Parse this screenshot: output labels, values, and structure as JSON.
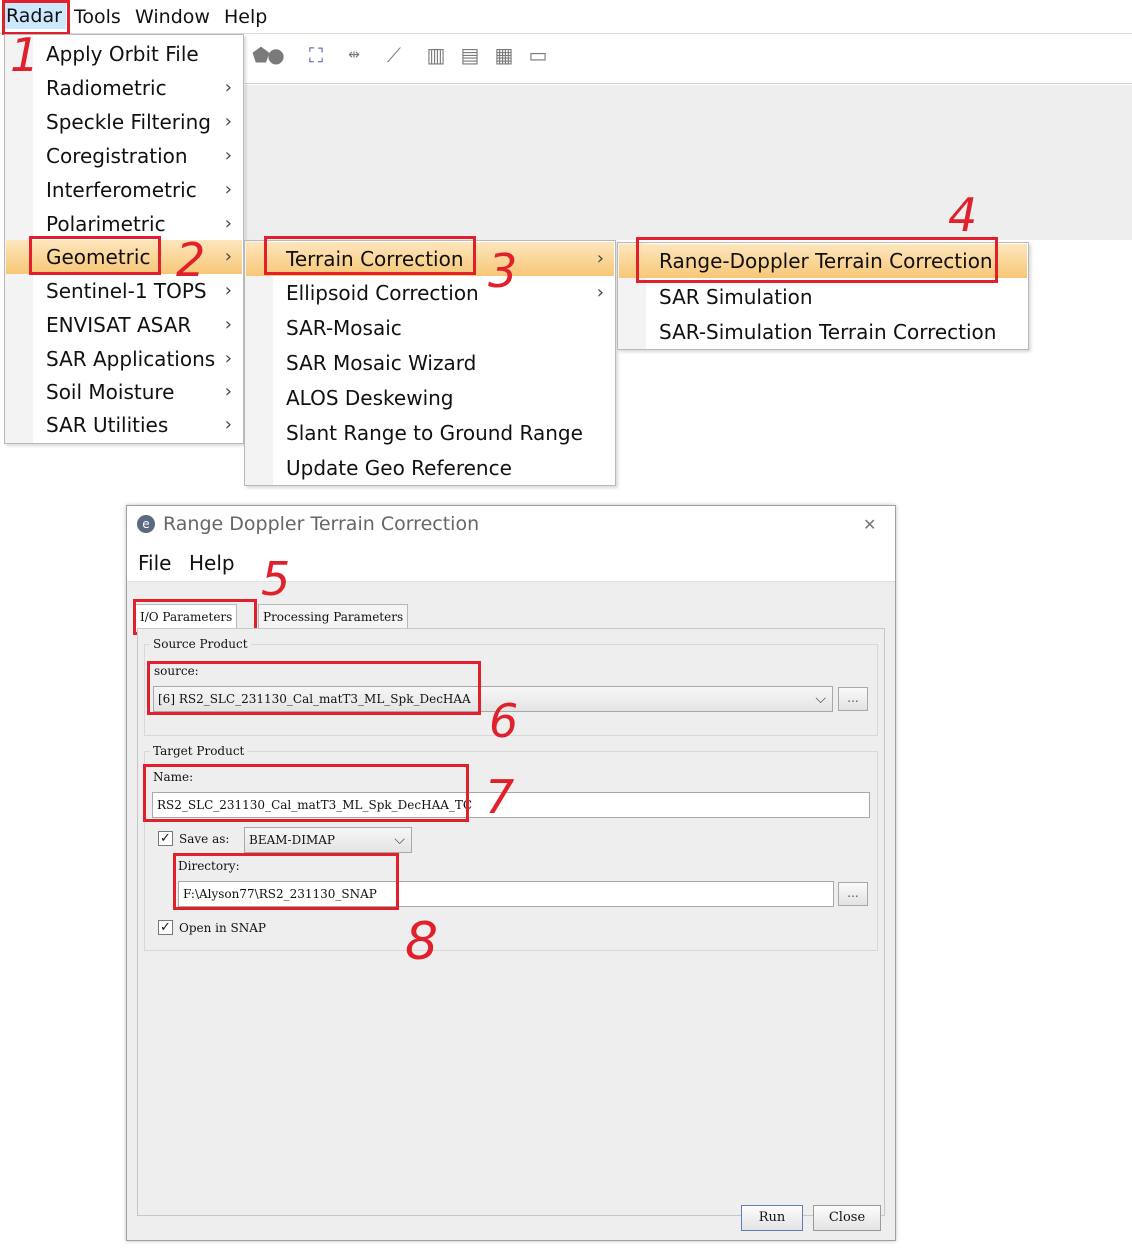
{
  "menubar": {
    "items": [
      "Radar",
      "Tools",
      "Window",
      "Help"
    ]
  },
  "toolbar": {
    "icons": [
      "shape-icon",
      "globe-icon",
      "window-star-icon",
      "distance-icon",
      "wand-icon",
      "tile-columns-icon",
      "tile-rows-icon",
      "tile-grid-icon",
      "folder-icon"
    ]
  },
  "radar_menu": {
    "items": [
      {
        "label": "Apply Orbit File",
        "submenu": false
      },
      {
        "label": "Radiometric",
        "submenu": true
      },
      {
        "label": "Speckle Filtering",
        "submenu": true
      },
      {
        "label": "Coregistration",
        "submenu": true
      },
      {
        "label": "Interferometric",
        "submenu": true
      },
      {
        "label": "Polarimetric",
        "submenu": true
      },
      {
        "label": "Geometric",
        "submenu": true
      },
      {
        "label": "Sentinel-1 TOPS",
        "submenu": true
      },
      {
        "label": "ENVISAT ASAR",
        "submenu": true
      },
      {
        "label": "SAR Applications",
        "submenu": true
      },
      {
        "label": "Soil Moisture",
        "submenu": true
      },
      {
        "label": "SAR Utilities",
        "submenu": true
      }
    ],
    "arrow": "›"
  },
  "geometric_menu": {
    "items": [
      {
        "label": "Terrain Correction",
        "submenu": true
      },
      {
        "label": "Ellipsoid Correction",
        "submenu": true
      },
      {
        "label": "SAR-Mosaic",
        "submenu": false
      },
      {
        "label": "SAR Mosaic Wizard",
        "submenu": false
      },
      {
        "label": "ALOS Deskewing",
        "submenu": false
      },
      {
        "label": "Slant Range to Ground Range",
        "submenu": false
      },
      {
        "label": "Update Geo Reference",
        "submenu": false
      }
    ]
  },
  "terrain_menu": {
    "items": [
      {
        "label": "Range-Doppler Terrain Correction"
      },
      {
        "label": "SAR Simulation"
      },
      {
        "label": "SAR-Simulation Terrain Correction"
      }
    ]
  },
  "annotations": [
    "1",
    "2",
    "3",
    "4",
    "5",
    "6",
    "7",
    "8"
  ],
  "dialog": {
    "title": "Range Doppler Terrain Correction",
    "close_glyph": "✕",
    "menu": [
      "File",
      "Help"
    ],
    "tabs": [
      "I/O Parameters",
      "Processing Parameters"
    ],
    "source_group": "Source Product",
    "source_label": "source:",
    "source_value": "[6] RS2_SLC_231130_Cal_matT3_ML_Spk_DecHAA",
    "browse": "...",
    "target_group": "Target Product",
    "name_label": "Name:",
    "name_value": "RS2_SLC_231130_Cal_matT3_ML_Spk_DecHAA_TC",
    "save_as_label": "Save as:",
    "save_as_value": "BEAM-DIMAP",
    "directory_label": "Directory:",
    "directory_value": "F:\\Alyson77\\RS2_231130_SNAP",
    "open_label": "Open in SNAP",
    "run": "Run",
    "close": "Close"
  },
  "colors": {
    "highlight": "#f7c777",
    "annotation_red": "#e0202b",
    "menubar_selected": "#cce8ff"
  }
}
